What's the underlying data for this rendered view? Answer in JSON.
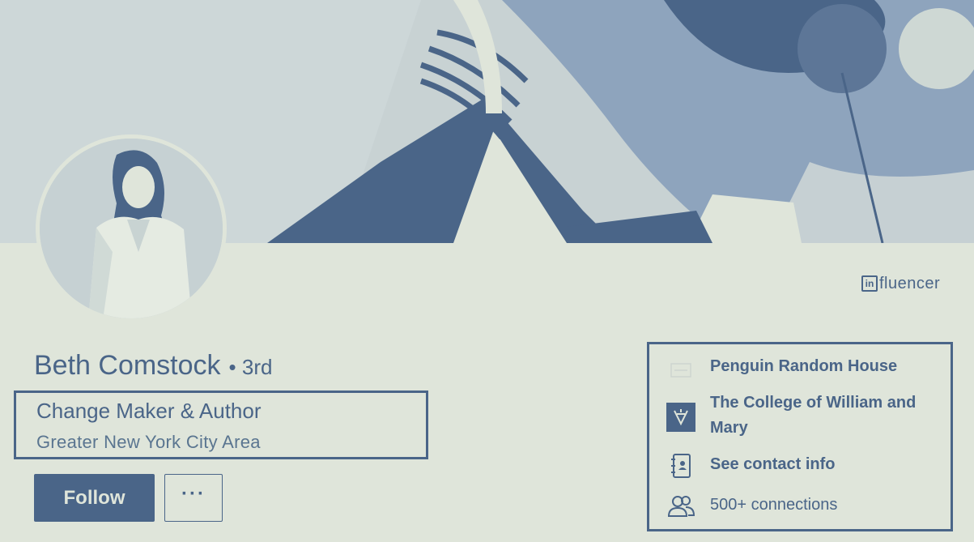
{
  "profile": {
    "name": "Beth Comstock",
    "degree": "• 3rd",
    "headline": "Change Maker & Author",
    "location": "Greater New York City Area",
    "badge_logo": "in",
    "badge_word": "fluencer"
  },
  "actions": {
    "follow_label": "Follow",
    "more_label": "···"
  },
  "sidebar": {
    "company": "Penguin Random House",
    "school_line1": "The College of William and",
    "school_line2": "Mary",
    "contact": "See contact info",
    "connections": "500+ connections"
  },
  "icons": {
    "company": "company-logo-icon",
    "school": "school-crest-icon",
    "contact": "contact-card-icon",
    "connections": "people-icon"
  },
  "colors": {
    "accent": "#4a6588",
    "background": "#dfe5da"
  }
}
